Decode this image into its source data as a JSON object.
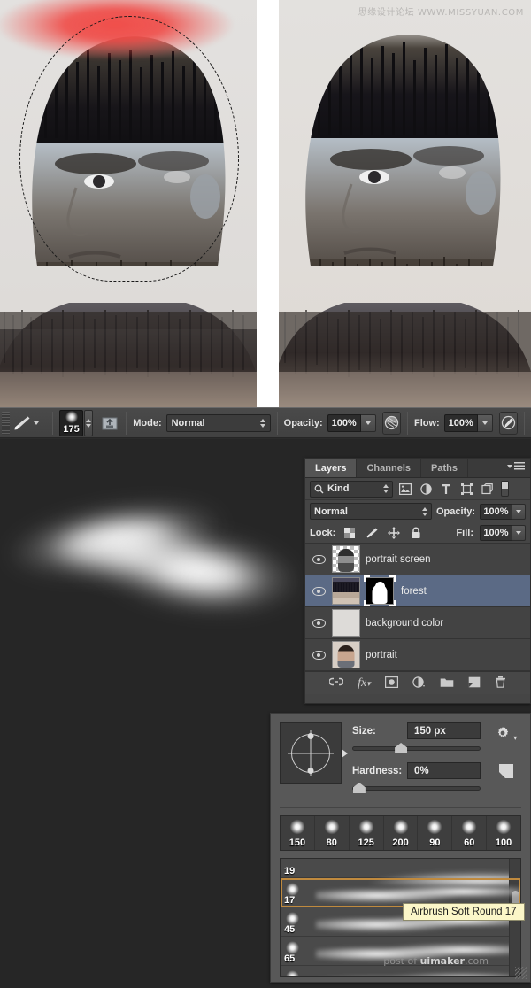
{
  "app": "Adobe Photoshop",
  "watermarks": {
    "top": "思缘设计论坛 WWW.MISSYUAN.COM",
    "bottom_prefix": "post of ",
    "bottom_brand": "uimaker",
    "bottom_suffix": ".com"
  },
  "canvas": {
    "left_doc_name": "portrait with red brush selection",
    "right_doc_name": "portrait forest double exposure result"
  },
  "options_bar": {
    "tool_icon": "brush-icon",
    "tool_preset_caret": "▾",
    "brush_size": "175",
    "airbrush_toggle_icon": "tablet-pressure-icon",
    "mode_label": "Mode:",
    "mode_value": "Normal",
    "opacity_label": "Opacity:",
    "opacity_value": "100%",
    "opacity_pressure_icon": "pressure-opacity-icon",
    "flow_label": "Flow:",
    "flow_value": "100%",
    "airbrush_icon": "airbrush-icon"
  },
  "layers_panel": {
    "tabs": [
      {
        "label": "Layers",
        "active": true
      },
      {
        "label": "Channels",
        "active": false
      },
      {
        "label": "Paths",
        "active": false
      }
    ],
    "menu_icon": "panel-menu-icon",
    "filter": {
      "search_icon": "search-icon",
      "kind_label": "Kind",
      "icons": [
        "pixel-filter-icon",
        "adjustment-filter-icon",
        "type-filter-icon",
        "shape-filter-icon",
        "smart-object-filter-icon"
      ],
      "toggle_icon": "filter-toggle-icon"
    },
    "blend": {
      "mode_value": "Normal",
      "opacity_label": "Opacity:",
      "opacity_value": "100%"
    },
    "lock": {
      "label": "Lock:",
      "icons": [
        "lock-transparency-icon",
        "lock-image-icon",
        "lock-position-icon",
        "lock-all-icon"
      ],
      "fill_label": "Fill:",
      "fill_value": "100%"
    },
    "layers": [
      {
        "name": "portrait screen",
        "visible": true,
        "selected": false,
        "thumb": "checker-face",
        "has_mask": false
      },
      {
        "name": "forest",
        "visible": true,
        "selected": true,
        "thumb": "forest",
        "has_mask": true
      },
      {
        "name": "background color",
        "visible": true,
        "selected": false,
        "thumb": "solid",
        "has_mask": false
      },
      {
        "name": "portrait",
        "visible": true,
        "selected": false,
        "thumb": "portrait",
        "has_mask": false
      }
    ],
    "footer_icons": [
      "link-layers-icon",
      "layer-style-fx-icon",
      "add-layer-mask-icon",
      "new-adjustment-layer-icon",
      "new-group-icon",
      "new-layer-icon",
      "delete-layer-icon"
    ]
  },
  "brush_panel": {
    "preview_icon": "brush-tip-preview-icon",
    "size_label": "Size:",
    "size_value": "150 px",
    "size_slider_percent": 38,
    "hardness_label": "Hardness:",
    "hardness_value": "0%",
    "hardness_slider_percent": 2,
    "gear_icon": "gear-icon",
    "new_preset_icon": "new-preset-icon",
    "preset_sizes": [
      "150",
      "80",
      "125",
      "200",
      "90",
      "60",
      "100"
    ],
    "preset_rows": [
      {
        "size": "19",
        "selected": false
      },
      {
        "size": "17",
        "selected": true
      },
      {
        "size": "45",
        "selected": false
      },
      {
        "size": "65",
        "selected": false
      },
      {
        "size": "",
        "selected": false
      }
    ],
    "tooltip": "Airbrush Soft Round 17"
  }
}
